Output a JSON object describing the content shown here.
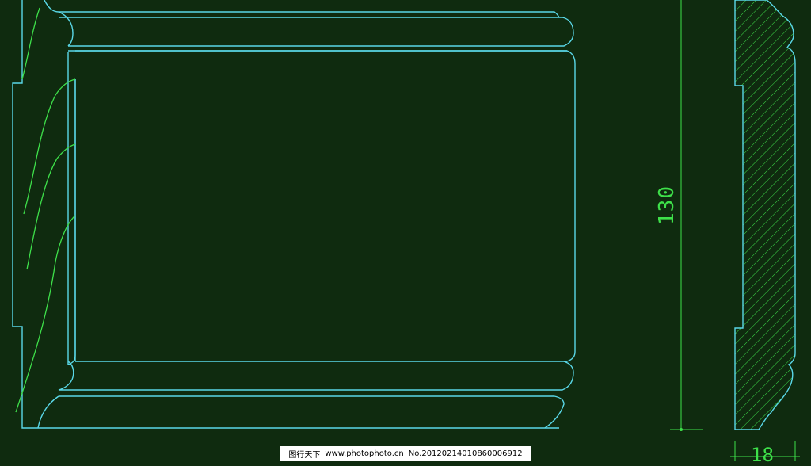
{
  "dimensions": {
    "height_label": "130",
    "thickness_label": "18"
  },
  "watermark": {
    "site_name": "图行天下",
    "site_url": "www.photophoto.cn",
    "image_no": "No.20120214010860006912"
  },
  "colors": {
    "background": "#0f2b0f",
    "outline": "#5ad8e8",
    "hatch": "#3ee04a"
  }
}
